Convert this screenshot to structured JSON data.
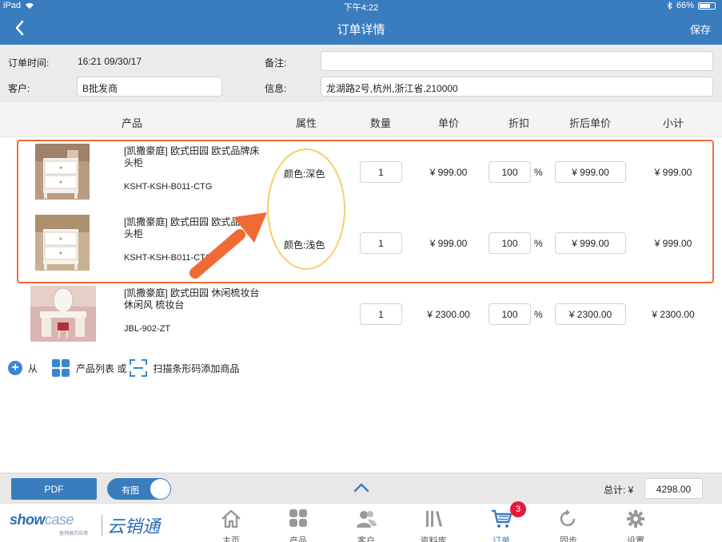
{
  "status_bar": {
    "device": "iPad",
    "time": "下午4:22",
    "battery": "66%"
  },
  "nav": {
    "title": "订单详情",
    "save_label": "保存"
  },
  "form": {
    "order_time_label": "订单时间:",
    "order_time_value": "16:21 09/30/17",
    "remark_label": "备注:",
    "remark_value": "",
    "customer_label": "客户:",
    "customer_value": "B批发商",
    "info_label": "信息:",
    "info_value": "龙湖路2号,杭州,浙江省,210000"
  },
  "columns": {
    "product": "产品",
    "attribute": "属性",
    "quantity": "数量",
    "unit_price": "单价",
    "discount": "折扣",
    "discounted_price": "折后单价",
    "subtotal": "小计"
  },
  "items": [
    {
      "name": "[凯撒豪庭] 欧式田园 欧式品牌床头柜",
      "sku": "KSHT-KSH-B011-CTG",
      "attribute": "颜色:深色",
      "quantity": "1",
      "unit_price": "¥ 999.00",
      "discount": "100",
      "discount_unit": "%",
      "discounted_price": "¥ 999.00",
      "subtotal": "¥ 999.00"
    },
    {
      "name": "[凯撒豪庭] 欧式田园 欧式品牌床头柜",
      "sku": "KSHT-KSH-B011-CTG",
      "attribute": "颜色:浅色",
      "quantity": "1",
      "unit_price": "¥ 999.00",
      "discount": "100",
      "discount_unit": "%",
      "discounted_price": "¥ 999.00",
      "subtotal": "¥ 999.00"
    },
    {
      "name": "[凯撒豪庭] 欧式田园 休闲梳妆台 休闲风 梳妆台",
      "sku": "JBL-902-ZT",
      "attribute": "",
      "quantity": "1",
      "unit_price": "¥ 2300.00",
      "discount": "100",
      "discount_unit": "%",
      "discounted_price": "¥ 2300.00",
      "subtotal": "¥ 2300.00"
    }
  ],
  "add_bar": {
    "from": "从",
    "product_list": "产品列表 或",
    "scan": "扫描条形码添加商品"
  },
  "bottom": {
    "pdf_label": "PDF",
    "image_toggle_label": "有图",
    "image_toggle_on": true,
    "total_label": "总计:  ¥",
    "total_value": "4298.00"
  },
  "logo": {
    "brand_show": "show",
    "brand_case": "case",
    "tagline": "营销展示应用",
    "cn_name": "云销通"
  },
  "tabs": [
    {
      "label": "主页",
      "icon": "home-icon"
    },
    {
      "label": "产品",
      "icon": "products-icon"
    },
    {
      "label": "客户",
      "icon": "customers-icon"
    },
    {
      "label": "资料库",
      "icon": "library-icon"
    },
    {
      "label": "订单",
      "icon": "cart-icon",
      "active": true,
      "badge": "3"
    },
    {
      "label": "同步",
      "icon": "sync-icon"
    },
    {
      "label": "设置",
      "icon": "gear-icon"
    }
  ],
  "colors": {
    "primary": "#3a7dbf",
    "highlight_border": "#f06a35",
    "ellipse": "#f6cf6c",
    "arrow": "#f06a35",
    "badge": "#e31b3a"
  }
}
